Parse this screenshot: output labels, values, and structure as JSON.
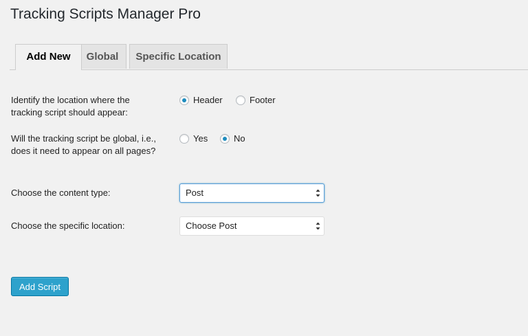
{
  "page": {
    "title": "Tracking Scripts Manager Pro"
  },
  "tabs": [
    {
      "label": "Add New",
      "active": true
    },
    {
      "label": "Global",
      "active": false
    },
    {
      "label": "Specific Location",
      "active": false
    }
  ],
  "form": {
    "location": {
      "label": "Identify the location where the tracking script should appear:",
      "options": [
        {
          "label": "Header",
          "checked": true
        },
        {
          "label": "Footer",
          "checked": false
        }
      ]
    },
    "global": {
      "label": "Will the tracking script be global, i.e., does it need to appear on all pages?",
      "options": [
        {
          "label": "Yes",
          "checked": false
        },
        {
          "label": "No",
          "checked": true
        }
      ]
    },
    "content_type": {
      "label": "Choose the content type:",
      "selected": "Post"
    },
    "specific_location": {
      "label": "Choose the specific location:",
      "selected": "Choose Post"
    }
  },
  "actions": {
    "add_script_label": "Add Script"
  },
  "colors": {
    "accent": "#2ea2cc",
    "radio_dot": "#1e8cbe",
    "background": "#f1f1f1"
  }
}
